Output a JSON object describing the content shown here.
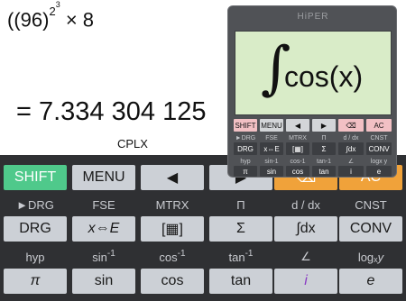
{
  "display": {
    "expression_base": "((96)",
    "expression_exp": "2",
    "expression_exp2": "3",
    "expression_tail": " × 8",
    "result": "= 7.334 304 125",
    "mode": "CPLX"
  },
  "keypad": {
    "row1": [
      "SHIFT",
      "MENU",
      "◀",
      "▶",
      "⌫",
      "AC"
    ],
    "row2_labels": [
      "►DRG",
      "FSE",
      "MTRX",
      "Π",
      "d / dx",
      "CNST"
    ],
    "row2": [
      "DRG",
      "x⇔E",
      "[▦]",
      "Σ",
      "∫dx",
      "CONV"
    ],
    "row3_labels": [
      "hyp",
      "sin",
      "cos",
      "tan",
      "∠",
      "log"
    ],
    "row3_sup": "-1",
    "row3_log_sub": "x",
    "row3_log_y": " y",
    "row4": [
      "π",
      "sin",
      "cos",
      "tan",
      "i",
      "e"
    ]
  },
  "card": {
    "title": "HiPER",
    "integral": "∫",
    "expr": "cos(x)",
    "row1": [
      "SHIFT",
      "MENU",
      "◀",
      "▶",
      "⌫",
      "AC"
    ],
    "row2_labels": [
      "►DRG",
      "FSE",
      "MTRX",
      "Π",
      "d / dx",
      "CNST"
    ],
    "row2": [
      "DRG",
      "x⇔E",
      "[▦]",
      "Σ",
      "∫dx",
      "CONV"
    ],
    "row3_labels": [
      "hyp",
      "sin-1",
      "cos-1",
      "tan-1",
      "∠",
      "logx y"
    ],
    "row4": [
      "π",
      "sin",
      "cos",
      "tan",
      "i",
      "e"
    ]
  },
  "colors": {
    "shift": "#4fc98b",
    "delete": "#f0a23a",
    "keypad_bg": "#2f3033",
    "key": "#ccd0d6",
    "screen": "#d9ecc8"
  }
}
